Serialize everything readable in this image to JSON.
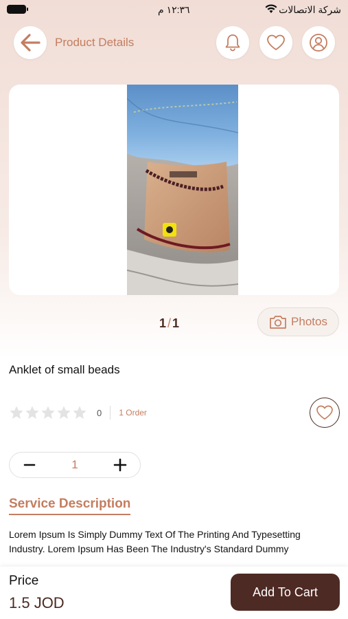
{
  "status_bar": {
    "time": "١٢:٣٦ م",
    "carrier": "شركة الاتصالات"
  },
  "header": {
    "title": "Product Details",
    "icons": [
      "back-arrow-icon",
      "bell-icon",
      "heart-icon",
      "user-icon"
    ]
  },
  "gallery": {
    "current": "1",
    "separator": "/",
    "total": "1",
    "photos_label": "Photos"
  },
  "product": {
    "name": "Anklet of small beads",
    "rating": 0,
    "rating_count": "0",
    "orders": "1 Order"
  },
  "quantity": {
    "value": "1"
  },
  "description": {
    "title": "Service Description",
    "text": "Lorem Ipsum Is Simply Dummy Text Of The Printing And Typesetting Industry. Lorem Ipsum Has Been The Industry's Standard Dummy"
  },
  "bottom_bar": {
    "price_label": "Price",
    "price_value": "1.5 JOD",
    "add_to_cart_label": "Add To Cart"
  },
  "colors": {
    "accent": "#c47d5f",
    "dark_brown": "#4e2a24",
    "background_tint": "#f1ddd6"
  }
}
